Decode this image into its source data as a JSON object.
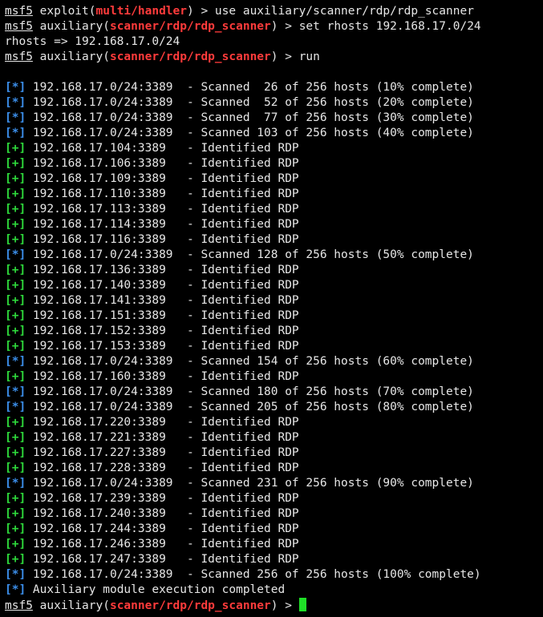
{
  "colors": {
    "background": "#000000",
    "text": "#e6e6e6",
    "module": "#ff3b3b",
    "info_tag": "#3b8eea",
    "good_tag": "#2ed93b",
    "cursor": "#1fe027"
  },
  "prompt_word": "msf5",
  "commands": [
    {
      "context": "exploit",
      "module": "multi/handler",
      "command": " > use auxiliary/scanner/rdp/rdp_scanner"
    },
    {
      "context": "auxiliary",
      "module": "scanner/rdp/rdp_scanner",
      "command": " > set rhosts 192.168.17.0/24"
    },
    {
      "echo": "rhosts => 192.168.17.0/24"
    },
    {
      "context": "auxiliary",
      "module": "scanner/rdp/rdp_scanner",
      "command": " > run"
    }
  ],
  "output": [
    {
      "type": "blank"
    },
    {
      "type": "info",
      "tag": "[*]",
      "text": " 192.168.17.0/24:3389  - Scanned  26 of 256 hosts (10% complete)"
    },
    {
      "type": "info",
      "tag": "[*]",
      "text": " 192.168.17.0/24:3389  - Scanned  52 of 256 hosts (20% complete)"
    },
    {
      "type": "info",
      "tag": "[*]",
      "text": " 192.168.17.0/24:3389  - Scanned  77 of 256 hosts (30% complete)"
    },
    {
      "type": "info",
      "tag": "[*]",
      "text": " 192.168.17.0/24:3389  - Scanned 103 of 256 hosts (40% complete)"
    },
    {
      "type": "good",
      "tag": "[+]",
      "text": " 192.168.17.104:3389   - Identified RDP"
    },
    {
      "type": "good",
      "tag": "[+]",
      "text": " 192.168.17.106:3389   - Identified RDP"
    },
    {
      "type": "good",
      "tag": "[+]",
      "text": " 192.168.17.109:3389   - Identified RDP"
    },
    {
      "type": "good",
      "tag": "[+]",
      "text": " 192.168.17.110:3389   - Identified RDP"
    },
    {
      "type": "good",
      "tag": "[+]",
      "text": " 192.168.17.113:3389   - Identified RDP"
    },
    {
      "type": "good",
      "tag": "[+]",
      "text": " 192.168.17.114:3389   - Identified RDP"
    },
    {
      "type": "good",
      "tag": "[+]",
      "text": " 192.168.17.116:3389   - Identified RDP"
    },
    {
      "type": "info",
      "tag": "[*]",
      "text": " 192.168.17.0/24:3389  - Scanned 128 of 256 hosts (50% complete)"
    },
    {
      "type": "good",
      "tag": "[+]",
      "text": " 192.168.17.136:3389   - Identified RDP"
    },
    {
      "type": "good",
      "tag": "[+]",
      "text": " 192.168.17.140:3389   - Identified RDP"
    },
    {
      "type": "good",
      "tag": "[+]",
      "text": " 192.168.17.141:3389   - Identified RDP"
    },
    {
      "type": "good",
      "tag": "[+]",
      "text": " 192.168.17.151:3389   - Identified RDP"
    },
    {
      "type": "good",
      "tag": "[+]",
      "text": " 192.168.17.152:3389   - Identified RDP"
    },
    {
      "type": "good",
      "tag": "[+]",
      "text": " 192.168.17.153:3389   - Identified RDP"
    },
    {
      "type": "info",
      "tag": "[*]",
      "text": " 192.168.17.0/24:3389  - Scanned 154 of 256 hosts (60% complete)"
    },
    {
      "type": "good",
      "tag": "[+]",
      "text": " 192.168.17.160:3389   - Identified RDP"
    },
    {
      "type": "info",
      "tag": "[*]",
      "text": " 192.168.17.0/24:3389  - Scanned 180 of 256 hosts (70% complete)"
    },
    {
      "type": "info",
      "tag": "[*]",
      "text": " 192.168.17.0/24:3389  - Scanned 205 of 256 hosts (80% complete)"
    },
    {
      "type": "good",
      "tag": "[+]",
      "text": " 192.168.17.220:3389   - Identified RDP"
    },
    {
      "type": "good",
      "tag": "[+]",
      "text": " 192.168.17.221:3389   - Identified RDP"
    },
    {
      "type": "good",
      "tag": "[+]",
      "text": " 192.168.17.227:3389   - Identified RDP"
    },
    {
      "type": "good",
      "tag": "[+]",
      "text": " 192.168.17.228:3389   - Identified RDP"
    },
    {
      "type": "info",
      "tag": "[*]",
      "text": " 192.168.17.0/24:3389  - Scanned 231 of 256 hosts (90% complete)"
    },
    {
      "type": "good",
      "tag": "[+]",
      "text": " 192.168.17.239:3389   - Identified RDP"
    },
    {
      "type": "good",
      "tag": "[+]",
      "text": " 192.168.17.240:3389   - Identified RDP"
    },
    {
      "type": "good",
      "tag": "[+]",
      "text": " 192.168.17.244:3389   - Identified RDP"
    },
    {
      "type": "good",
      "tag": "[+]",
      "text": " 192.168.17.246:3389   - Identified RDP"
    },
    {
      "type": "good",
      "tag": "[+]",
      "text": " 192.168.17.247:3389   - Identified RDP"
    },
    {
      "type": "info",
      "tag": "[*]",
      "text": " 192.168.17.0/24:3389  - Scanned 256 of 256 hosts (100% complete)"
    },
    {
      "type": "info",
      "tag": "[*]",
      "text": " Auxiliary module execution completed"
    }
  ],
  "final_prompt": {
    "context": "auxiliary",
    "module": "scanner/rdp/rdp_scanner",
    "command": " > "
  }
}
